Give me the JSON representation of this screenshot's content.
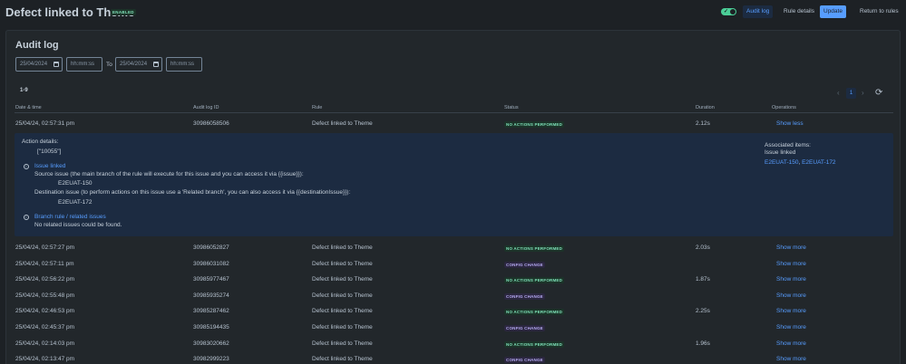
{
  "header": {
    "title": "Defect linked to Theme",
    "badge": "ENABLED",
    "toggle_on": true,
    "buttons": {
      "audit_log": "Audit log",
      "rule_details": "Rule details",
      "update": "Update",
      "return": "Return to rules"
    }
  },
  "audit": {
    "title": "Audit log",
    "from_date": "25/04/2024",
    "from_time_placeholder": "hh:mm:ss",
    "to_label": "To",
    "to_date": "25/04/2024",
    "to_time_placeholder": "hh:mm:ss",
    "range": "1-9",
    "current_page": "1"
  },
  "table": {
    "columns": [
      "Date & time",
      "Audit log ID",
      "Rule",
      "Status",
      "Duration",
      "Operations"
    ],
    "rows": [
      {
        "date": "25/04/24, 02:57:31 pm",
        "id": "30986058506",
        "rule": "Defect linked to Theme",
        "status": "NO ACTIONS PERFORMED",
        "duration": "2.12s",
        "op": "Show less"
      },
      {
        "date": "25/04/24, 02:57:27 pm",
        "id": "30986052827",
        "rule": "Defect linked to Theme",
        "status": "NO ACTIONS PERFORMED",
        "duration": "2.03s",
        "op": "Show more"
      },
      {
        "date": "25/04/24, 02:57:11 pm",
        "id": "30986031082",
        "rule": "Defect linked to Theme",
        "status": "CONFIG CHANGE",
        "duration": "",
        "op": "Show more"
      },
      {
        "date": "25/04/24, 02:56:22 pm",
        "id": "30985977467",
        "rule": "Defect linked to Theme",
        "status": "NO ACTIONS PERFORMED",
        "duration": "1.87s",
        "op": "Show more"
      },
      {
        "date": "25/04/24, 02:55:48 pm",
        "id": "30985935274",
        "rule": "Defect linked to Theme",
        "status": "CONFIG CHANGE",
        "duration": "",
        "op": "Show more"
      },
      {
        "date": "25/04/24, 02:46:53 pm",
        "id": "30985287462",
        "rule": "Defect linked to Theme",
        "status": "NO ACTIONS PERFORMED",
        "duration": "2.25s",
        "op": "Show more"
      },
      {
        "date": "25/04/24, 02:45:37 pm",
        "id": "30985194435",
        "rule": "Defect linked to Theme",
        "status": "CONFIG CHANGE",
        "duration": "",
        "op": "Show more"
      },
      {
        "date": "25/04/24, 02:14:03 pm",
        "id": "30983020662",
        "rule": "Defect linked to Theme",
        "status": "NO ACTIONS PERFORMED",
        "duration": "1.96s",
        "op": "Show more"
      },
      {
        "date": "25/04/24, 02:13:47 pm",
        "id": "30982999223",
        "rule": "Defect linked to Theme",
        "status": "CONFIG CHANGE",
        "duration": "",
        "op": "Show more"
      }
    ]
  },
  "detail": {
    "action_details_label": "Action details:",
    "action_value": "[\"10055\"]",
    "issue_linked_title": "Issue linked",
    "source_text": "Source issue (the main branch of the rule will execute for this issue and you can access it via {{issue}}):",
    "source_key": "E2EUAT-150",
    "dest_text": "Destination issue (to perform actions on this issue use a 'Related branch', you can also access it via {{destinationIssue}}):",
    "dest_key": "E2EUAT-172",
    "branch_title": "Branch rule / related issues",
    "branch_text": "No related issues could be found.",
    "associated_label": "Associated items:",
    "associated_sub": "Issue linked",
    "associated_link1": "E2EUAT-150",
    "associated_sep": ", ",
    "associated_link2": "E2EUAT-172"
  },
  "colors": {
    "background": "#1d2125",
    "accent": "#579dff",
    "success": "#7ee2b8",
    "discovery": "#b8acf6"
  },
  "icons": {
    "calendar": "calendar-icon",
    "info": "info-icon",
    "refresh": "refresh-icon",
    "check": "check-icon"
  }
}
